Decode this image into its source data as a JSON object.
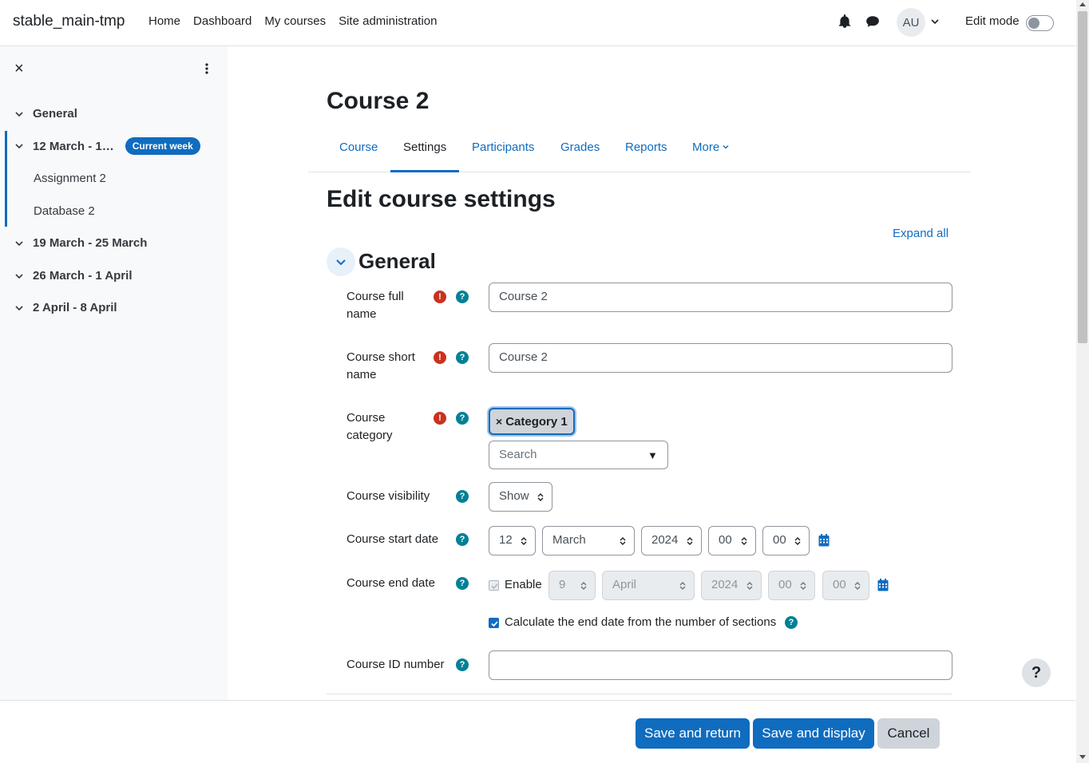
{
  "site_name": "stable_main-tmp",
  "topnav": [
    "Home",
    "Dashboard",
    "My courses",
    "Site administration"
  ],
  "icons": {
    "notifications": "bell-icon",
    "messages": "chat-bubble-icon",
    "user_menu": "chevron-down-icon"
  },
  "user": {
    "initials": "AU"
  },
  "edit_mode": {
    "label": "Edit mode",
    "on": false
  },
  "drawer": {
    "close": "×",
    "sections": [
      {
        "label": "General"
      },
      {
        "label": "12 March - 1…",
        "badge": "Current week",
        "items": [
          "Assignment 2",
          "Database 2"
        ]
      },
      {
        "label": "19 March - 25 March"
      },
      {
        "label": "26 March - 1 April"
      },
      {
        "label": "2 April - 8 April"
      }
    ]
  },
  "course_title": "Course 2",
  "tabs": [
    {
      "label": "Course",
      "active": false
    },
    {
      "label": "Settings",
      "active": true
    },
    {
      "label": "Participants",
      "active": false
    },
    {
      "label": "Grades",
      "active": false
    },
    {
      "label": "Reports",
      "active": false
    },
    {
      "label": "More",
      "active": false
    }
  ],
  "page_heading": "Edit course settings",
  "expand_all": "Expand all",
  "section": {
    "title": "General"
  },
  "form": {
    "fullname": {
      "label_line1": "Course full",
      "label_line2": "name",
      "value": "Course 2"
    },
    "shortname": {
      "label_line1": "Course short",
      "label_line2": "name",
      "value": "Course 2"
    },
    "category": {
      "label_line1": "Course",
      "label_line2": "category",
      "selected": "Category 1",
      "remove": "×",
      "search_placeholder": "Search",
      "caret": "▼"
    },
    "visibility": {
      "label": "Course visibility",
      "value": "Show"
    },
    "startdate": {
      "label": "Course start date",
      "day": "12",
      "month": "March",
      "year": "2024",
      "hour": "00",
      "minute": "00"
    },
    "enddate": {
      "label": "Course end date",
      "enable_label": "Enable",
      "enabled": true,
      "day": "9",
      "month": "April",
      "year": "2024",
      "hour": "00",
      "minute": "00"
    },
    "calc_end": {
      "label": "Calculate the end date from the number of sections",
      "checked": true
    },
    "idnumber": {
      "label": "Course ID number",
      "value": ""
    }
  },
  "help_glyph": "?",
  "required_glyph": "!",
  "buttons": {
    "save_return": "Save and return",
    "save_display": "Save and display",
    "cancel": "Cancel"
  },
  "colors": {
    "primary": "#0f6cbf",
    "required": "#ca3120",
    "help": "#008196"
  }
}
